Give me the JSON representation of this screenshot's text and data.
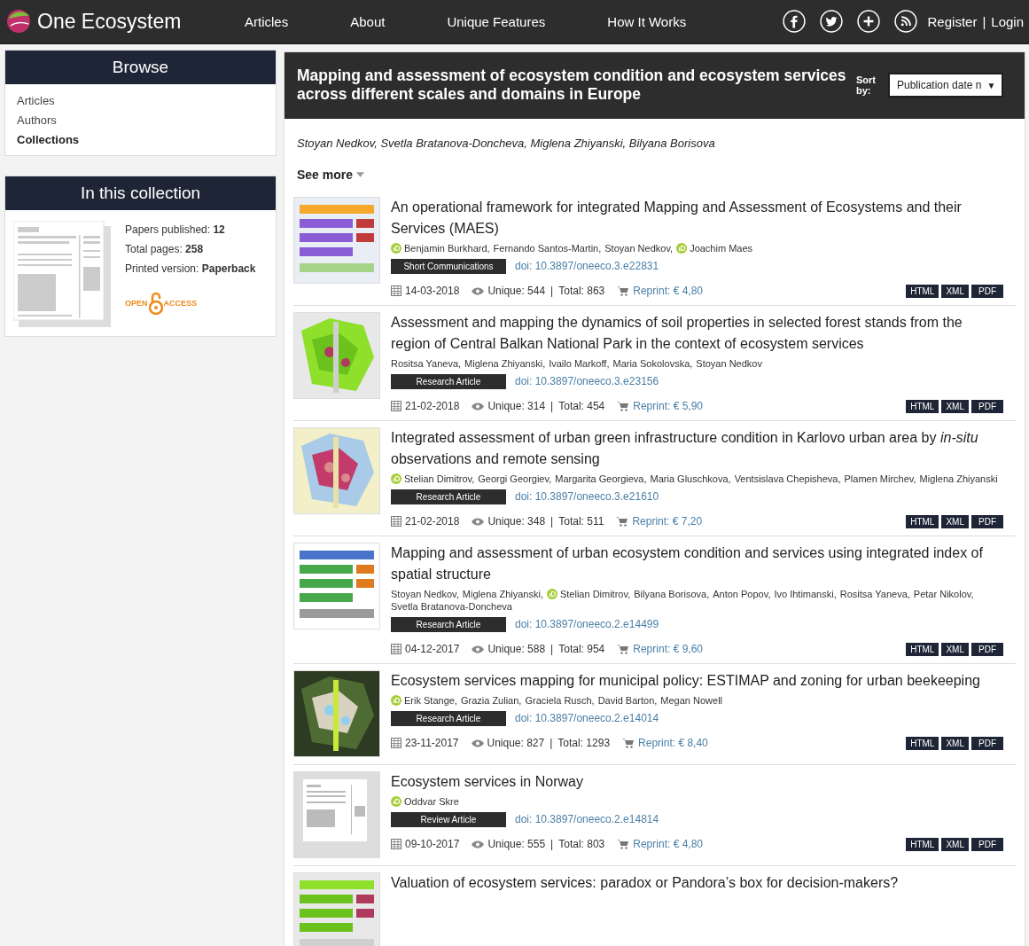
{
  "site": {
    "name": "One Ecosystem"
  },
  "nav": [
    {
      "label": "Articles"
    },
    {
      "label": "About"
    },
    {
      "label": "Unique Features"
    },
    {
      "label": "How It Works"
    }
  ],
  "social": [
    {
      "kind": "facebook"
    },
    {
      "kind": "twitter"
    },
    {
      "kind": "plus"
    },
    {
      "kind": "rss"
    }
  ],
  "account": {
    "register": "Register",
    "separator": "|",
    "login": "Login"
  },
  "browse": {
    "title": "Browse",
    "items": [
      {
        "label": "Articles",
        "selected": false
      },
      {
        "label": "Authors",
        "selected": false
      },
      {
        "label": "Collections",
        "selected": true
      }
    ]
  },
  "collection_info": {
    "title": "In this collection",
    "stats": [
      {
        "label": "Papers published:",
        "value": "12"
      },
      {
        "label": "Total pages:",
        "value": "258"
      },
      {
        "label": "Printed version:",
        "value": "Paperback"
      }
    ],
    "open_access": {
      "left": "OPEN",
      "right": "ACCESS"
    }
  },
  "collection": {
    "title": "Mapping and assessment of ecosystem condition and ecosystem services across different scales and domains in Europe",
    "sort": {
      "label": "Sort by:",
      "value": "Publication date n",
      "caret": "▼"
    },
    "editors": "Stoyan Nedkov, Svetla Bratanova-Doncheva, Miglena Zhiyanski, Bilyana Borisova",
    "see_more": "See more"
  },
  "articles": [
    {
      "thumbnail": {
        "kind": "picture"
      },
      "title": "An operational framework for integrated Mapping and Assessment of Ecosystems and their Services (MAES)",
      "authors": [
        {
          "name": "Benjamin Burkhard,",
          "orcid": true
        },
        {
          "name": "Fernando Santos-Martin,",
          "orcid": false
        },
        {
          "name": "Stoyan Nedkov,",
          "orcid": false
        },
        {
          "name": "Joachim Maes",
          "orcid": true
        }
      ],
      "type": "Short Communications",
      "doi": "doi: 10.3897/oneeco.3.e22831",
      "date": "14-03-2018",
      "unique": "Unique: 544",
      "separator": "|",
      "total": "Total: 863",
      "reprint": "Reprint: € 4,80",
      "formats": [
        "HTML",
        "XML",
        "PDF"
      ]
    },
    {
      "thumbnail": {
        "kind": "picture"
      },
      "title": "Assessment and mapping the dynamics of soil properties in selected forest stands from the region of Central Balkan National Park in the context of ecosystem services",
      "authors": [
        {
          "name": "Rositsa Yaneva,",
          "orcid": false
        },
        {
          "name": "Miglena Zhiyanski,",
          "orcid": false
        },
        {
          "name": "Ivailo Markoff,",
          "orcid": false
        },
        {
          "name": "Maria Sokolovska,",
          "orcid": false
        },
        {
          "name": "Stoyan Nedkov",
          "orcid": false
        }
      ],
      "type": "Research Article",
      "doi": "doi: 10.3897/oneeco.3.e23156",
      "date": "21-02-2018",
      "unique": "Unique: 314",
      "separator": "|",
      "total": "Total: 454",
      "reprint": "Reprint: € 5,90",
      "formats": [
        "HTML",
        "XML",
        "PDF"
      ]
    },
    {
      "thumbnail": {
        "kind": "picture"
      },
      "title": "Integrated assessment of urban green infrastructure condition in Karlovo urban area by *in-situ* observations and remote sensing",
      "authors": [
        {
          "name": "Stelian Dimitrov,",
          "orcid": true
        },
        {
          "name": "Georgi Georgiev,",
          "orcid": false
        },
        {
          "name": "Margarita Georgieva,",
          "orcid": false
        },
        {
          "name": "Maria Gluschkova,",
          "orcid": false
        },
        {
          "name": "Ventsislava Chepisheva,",
          "orcid": false
        },
        {
          "name": "Plamen Mirchev,",
          "orcid": false
        },
        {
          "name": "Miglena Zhiyanski",
          "orcid": false
        }
      ],
      "type": "Research Article",
      "doi": "doi: 10.3897/oneeco.3.e21610",
      "date": "21-02-2018",
      "unique": "Unique: 348",
      "separator": "|",
      "total": "Total: 511",
      "reprint": "Reprint: € 7,20",
      "formats": [
        "HTML",
        "XML",
        "PDF"
      ]
    },
    {
      "thumbnail": {
        "kind": "picture"
      },
      "title": "Mapping and assessment of urban ecosystem condition and services using integrated index of spatial structure",
      "authors": [
        {
          "name": "Stoyan Nedkov,",
          "orcid": false
        },
        {
          "name": "Miglena Zhiyanski,",
          "orcid": false
        },
        {
          "name": "Stelian Dimitrov,",
          "orcid": true
        },
        {
          "name": "Bilyana Borisova,",
          "orcid": false
        },
        {
          "name": "Anton Popov,",
          "orcid": false
        },
        {
          "name": "Ivo Ihtimanski,",
          "orcid": false
        },
        {
          "name": "Rositsa Yaneva,",
          "orcid": false
        },
        {
          "name": "Petar Nikolov,",
          "orcid": false
        },
        {
          "name": "Svetla Bratanova-Doncheva",
          "orcid": false
        }
      ],
      "type": "Research Article",
      "doi": "doi: 10.3897/oneeco.2.e14499",
      "date": "04-12-2017",
      "unique": "Unique: 588",
      "separator": "|",
      "total": "Total: 954",
      "reprint": "Reprint: € 9,60",
      "formats": [
        "HTML",
        "XML",
        "PDF"
      ]
    },
    {
      "thumbnail": {
        "kind": "picture"
      },
      "title": "Ecosystem services mapping for municipal policy: ESTIMAP and zoning for urban beekeeping",
      "authors": [
        {
          "name": "Erik Stange,",
          "orcid": true
        },
        {
          "name": "Grazia Zulian,",
          "orcid": false
        },
        {
          "name": "Graciela Rusch,",
          "orcid": false
        },
        {
          "name": "David Barton,",
          "orcid": false
        },
        {
          "name": "Megan Nowell",
          "orcid": false
        }
      ],
      "type": "Research Article",
      "doi": "doi: 10.3897/oneeco.2.e14014",
      "date": "23-11-2017",
      "unique": "Unique: 827",
      "separator": "|",
      "total": "Total: 1293",
      "reprint": "Reprint: € 8,40",
      "formats": [
        "HTML",
        "XML",
        "PDF"
      ]
    },
    {
      "thumbnail": {
        "kind": "placeholder"
      },
      "title": "Ecosystem services in Norway",
      "authors": [
        {
          "name": "Oddvar Skre",
          "orcid": true
        }
      ],
      "type": "Review Article",
      "doi": "doi: 10.3897/oneeco.2.e14814",
      "date": "09-10-2017",
      "unique": "Unique: 555",
      "separator": "|",
      "total": "Total: 803",
      "reprint": "Reprint: € 4,80",
      "formats": [
        "HTML",
        "XML",
        "PDF"
      ]
    },
    {
      "thumbnail": {
        "kind": "picture"
      },
      "title": "Valuation of ecosystem services: paradox or Pandora’s box for decision-makers?"
    }
  ]
}
